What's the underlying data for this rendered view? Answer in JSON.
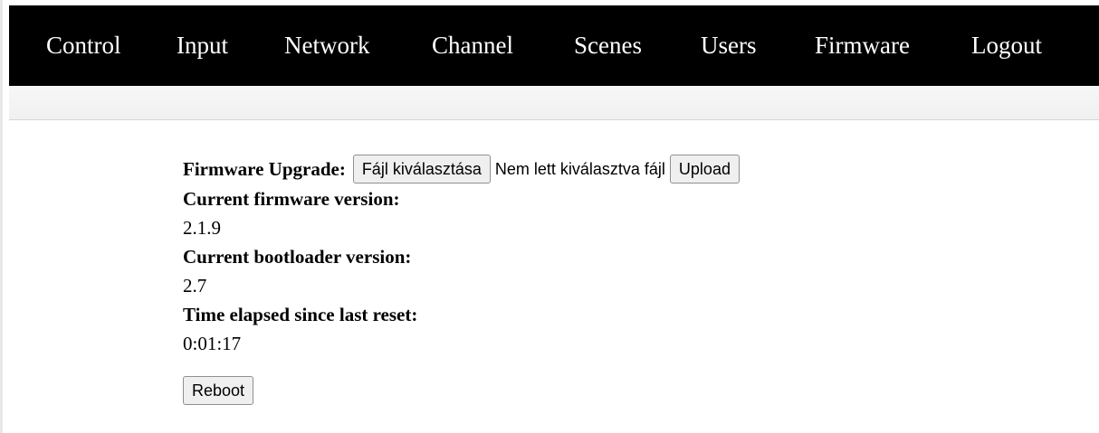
{
  "nav": {
    "items": [
      {
        "label": "Control"
      },
      {
        "label": "Input"
      },
      {
        "label": "Network"
      },
      {
        "label": "Channel"
      },
      {
        "label": "Scenes"
      },
      {
        "label": "Users"
      },
      {
        "label": "Firmware"
      },
      {
        "label": "Logout"
      }
    ]
  },
  "firmware": {
    "upgrade_label": "Firmware Upgrade:",
    "choose_file_label": "Fájl kiválasztása",
    "no_file_text": "Nem lett kiválasztva fájl",
    "upload_label": "Upload",
    "current_fw_label": "Current firmware version:",
    "current_fw_value": "2.1.9",
    "bootloader_label": "Current bootloader version:",
    "bootloader_value": "2.7",
    "elapsed_label": "Time elapsed since last reset:",
    "elapsed_value": "0:01:17",
    "reboot_label": "Reboot"
  },
  "colors": {
    "navbar_bg": "#000000",
    "navbar_text": "#ffffff"
  }
}
